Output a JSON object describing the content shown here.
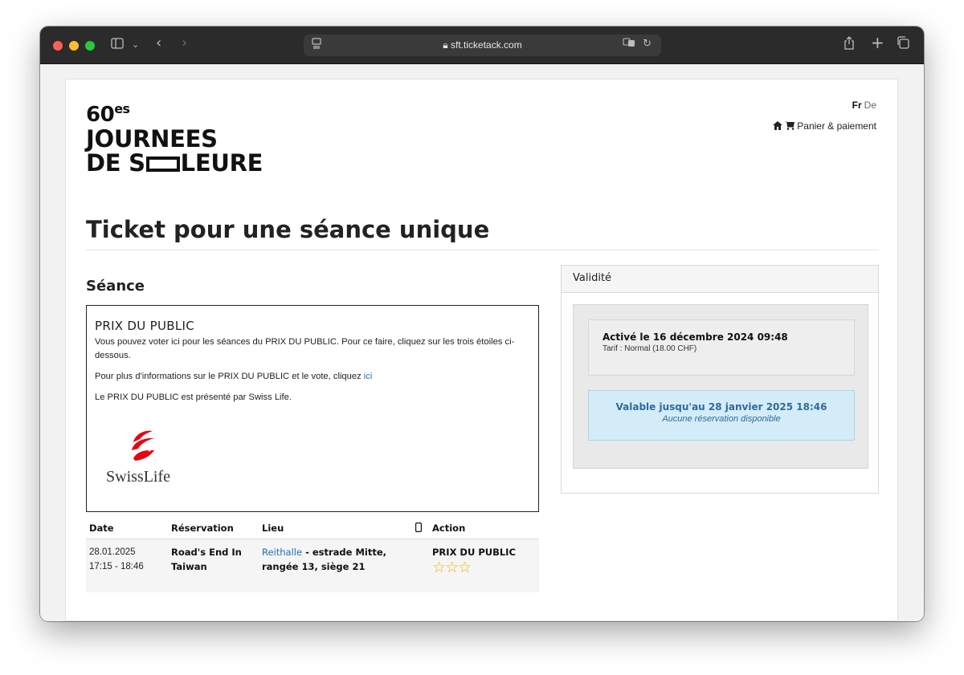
{
  "browser": {
    "url": "sft.ticketack.com"
  },
  "header": {
    "logo_line1": "60",
    "logo_sup": "es",
    "logo_line2": "JOURNEES",
    "logo_line3a": "DE S",
    "logo_line3b": "LEURE",
    "lang_active": "Fr",
    "lang_other": "De",
    "cart_label": "Panier & paiement"
  },
  "main": {
    "title": "Ticket pour une séance unique",
    "section_title": "Séance",
    "info": {
      "title": "PRIX DU PUBLIC",
      "p1": "Vous pouvez voter ici pour les séances du PRIX DU PUBLIC. Pour ce faire, cliquez sur les trois étoiles ci-dessous.",
      "p2_prefix": "Pour plus d'informations sur le PRIX DU PUBLIC et le vote, cliquez ",
      "p2_link": "ici",
      "p3": "Le PRIX DU PUBLIC est présenté par Swiss Life.",
      "sponsor_logo_text": "SwissLife"
    },
    "table": {
      "headers": {
        "date": "Date",
        "reservation": "Réservation",
        "lieu": "Lieu",
        "action": "Action"
      },
      "row": {
        "date": "28.01.2025",
        "time": "17:15 - 18:46",
        "reservation_line1": "Road's End In",
        "reservation_line2": "Taiwan",
        "lieu_link": "Reithalle",
        "lieu_rest1": " - estrade Mitte,",
        "lieu_rest2": "rangée 13, siège 21",
        "action_label": "PRIX DU PUBLIC",
        "stars": "☆☆☆"
      }
    }
  },
  "validity": {
    "title": "Validité",
    "activated": "Activé le 16 décembre 2024 09:48",
    "tarif": "Tarif : Normal (18.00 CHF)",
    "valid_until": "Valable jusqu'au 28 janvier 2025 18:46",
    "no_reservation": "Aucune réservation disponible"
  }
}
